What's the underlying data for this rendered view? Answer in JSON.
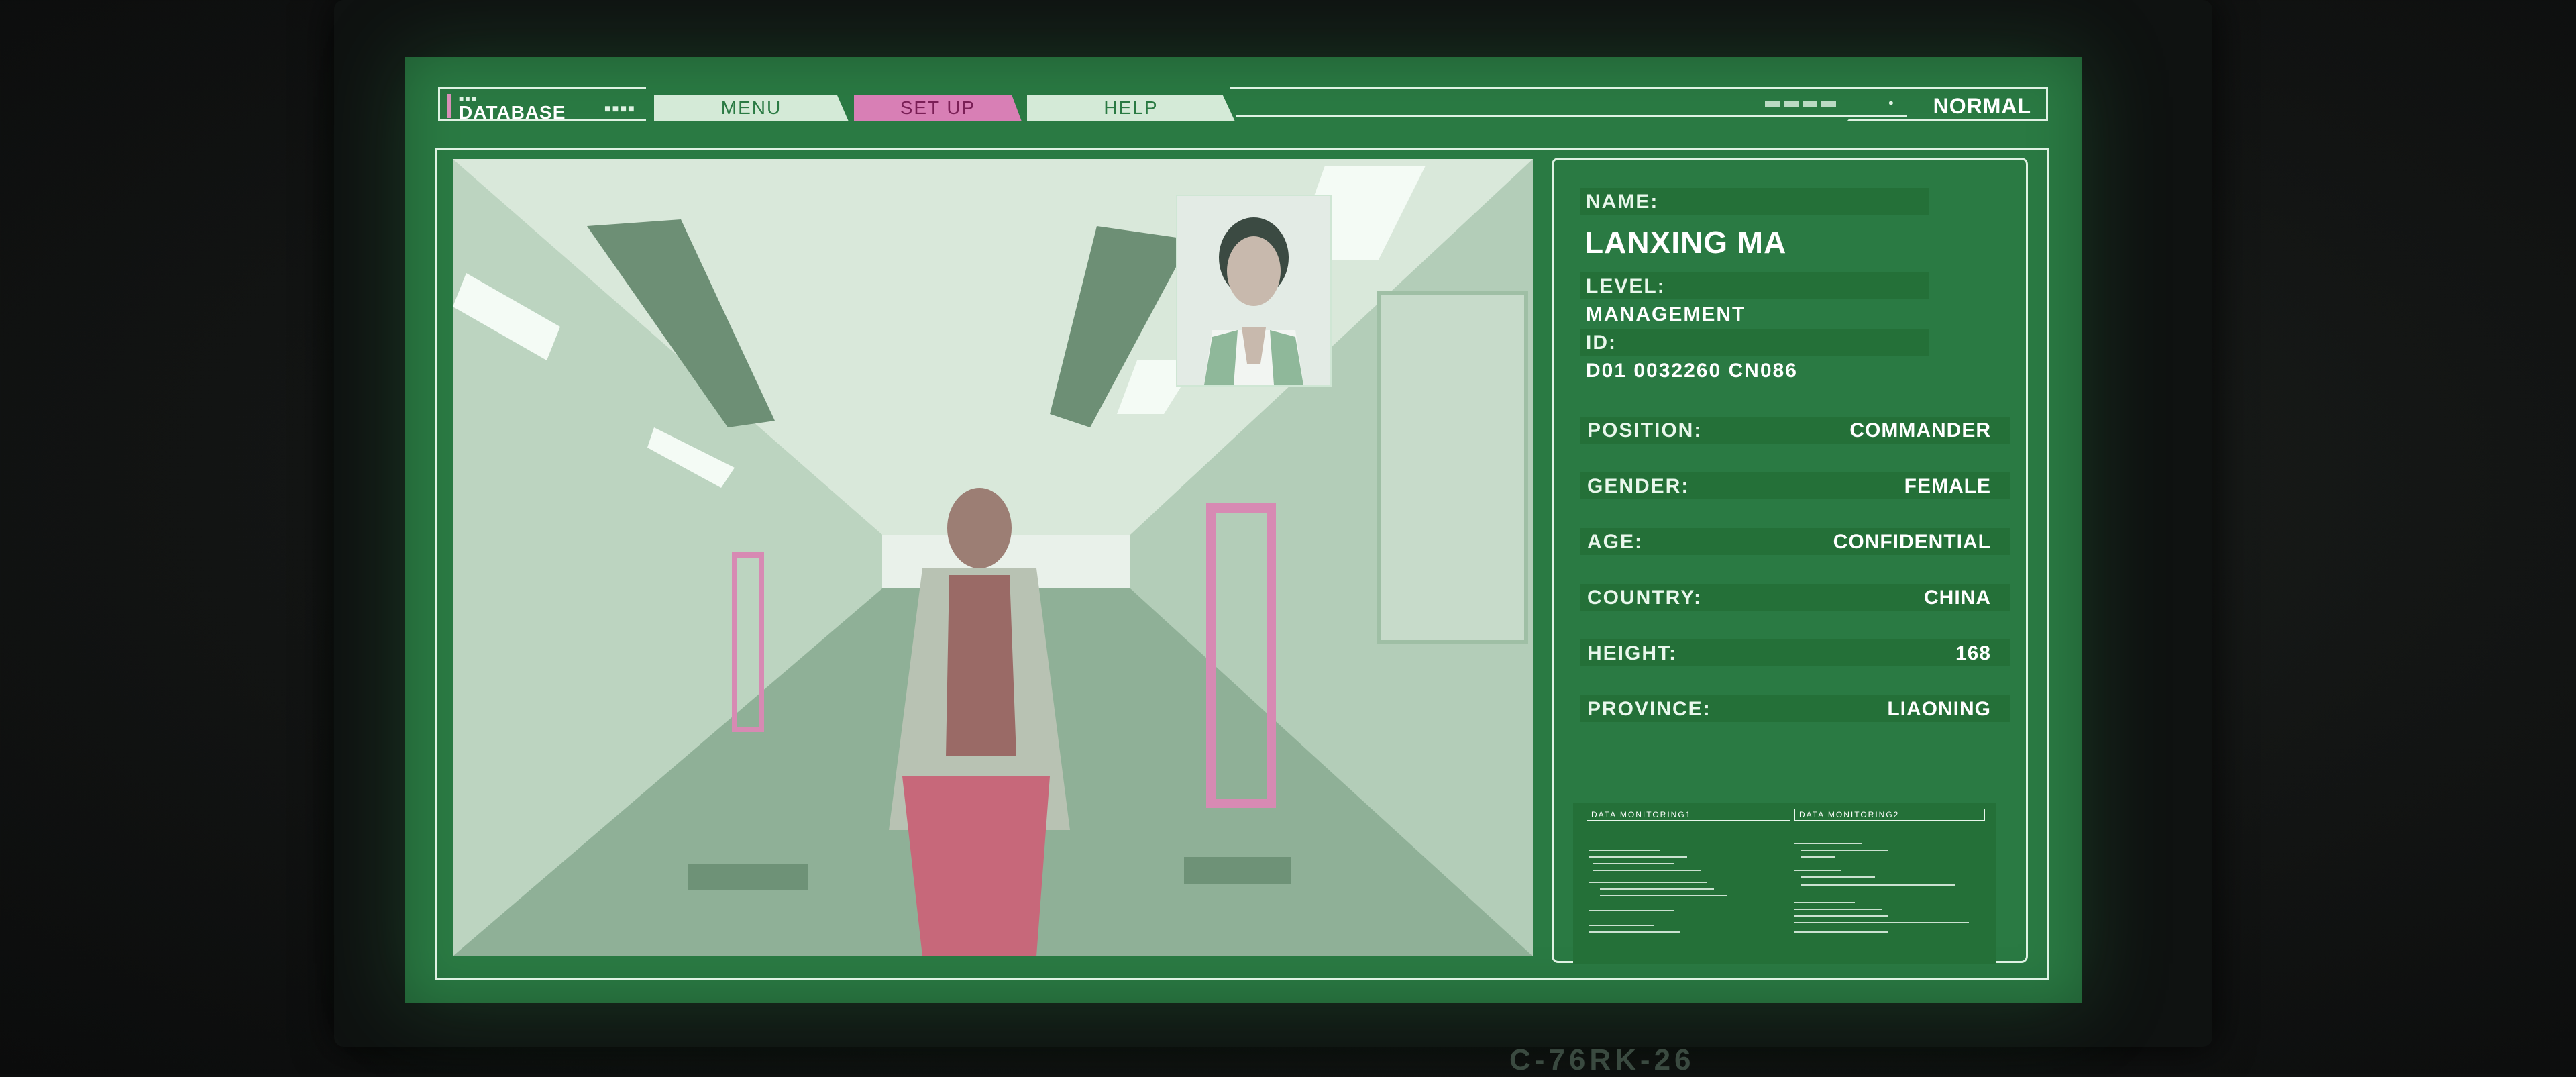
{
  "topbar": {
    "database_label": "DATABASE",
    "tabs": [
      {
        "label": "MENU"
      },
      {
        "label": "SET UP"
      },
      {
        "label": "HELP"
      }
    ],
    "status_label": "NORMAL"
  },
  "profile": {
    "name_label": "NAME:",
    "name_value": "LANXING MA",
    "level_label": "LEVEL:",
    "level_value": "MANAGEMENT",
    "id_label": "ID:",
    "id_value": "D01 0032260 CN086",
    "rows": [
      {
        "label": "POSITION:",
        "value": "COMMANDER"
      },
      {
        "label": "GENDER:",
        "value": "FEMALE"
      },
      {
        "label": "AGE:",
        "value": "CONFIDENTIAL"
      },
      {
        "label": "COUNTRY:",
        "value": "CHINA"
      },
      {
        "label": "HEIGHT:",
        "value": "168"
      },
      {
        "label": "PROVINCE:",
        "value": "LIAONING"
      }
    ]
  },
  "monitoring": {
    "panel1_title": "DATA MONITORING1",
    "panel2_title": "DATA MONITORING2"
  },
  "bezel_text": "C-76RK-26",
  "colors": {
    "screen": "#2a7a43",
    "bar": "#247038",
    "accent_pink": "#d87fb5",
    "frame": "#dff2e3"
  },
  "icons": [
    "signal-icon"
  ]
}
